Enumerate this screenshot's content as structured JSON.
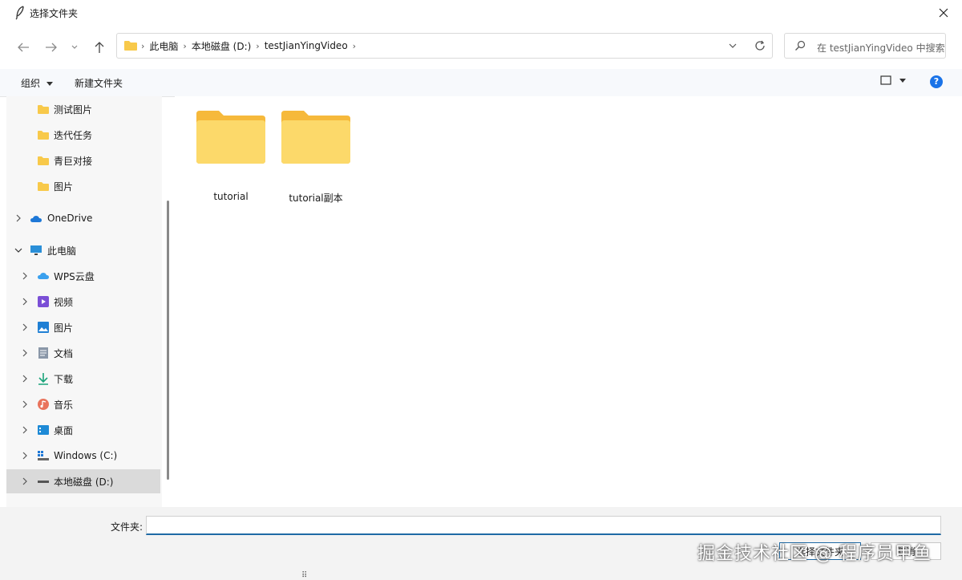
{
  "window": {
    "title": "选择文件夹"
  },
  "address": {
    "crumbs": [
      "此电脑",
      "本地磁盘 (D:)",
      "testJianYingVideo"
    ]
  },
  "search": {
    "placeholder": "在 testJianYingVideo 中搜索"
  },
  "toolbar": {
    "organize_label": "组织",
    "new_folder_label": "新建文件夹"
  },
  "sidebar": {
    "items": [
      {
        "label": "测试图片",
        "icon": "folder-icon"
      },
      {
        "label": "迭代任务",
        "icon": "folder-icon"
      },
      {
        "label": "青巨对接",
        "icon": "folder-icon"
      },
      {
        "label": "图片",
        "icon": "folder-icon"
      },
      {
        "label": "OneDrive",
        "icon": "cloud-icon"
      },
      {
        "label": "此电脑",
        "icon": "computer-icon"
      },
      {
        "label": "WPS云盘",
        "icon": "cloud-icon"
      },
      {
        "label": "视频",
        "icon": "video-icon"
      },
      {
        "label": "图片",
        "icon": "picture-icon"
      },
      {
        "label": "文档",
        "icon": "document-icon"
      },
      {
        "label": "下载",
        "icon": "download-icon"
      },
      {
        "label": "音乐",
        "icon": "music-icon"
      },
      {
        "label": "桌面",
        "icon": "desktop-icon"
      },
      {
        "label": "Windows (C:)",
        "icon": "drive-icon"
      },
      {
        "label": "本地磁盘 (D:)",
        "icon": "drive-icon",
        "selected": true
      }
    ]
  },
  "files": [
    {
      "name": "tutorial",
      "icon": "folder-icon"
    },
    {
      "name": "tutorial副本",
      "icon": "folder-icon"
    }
  ],
  "footer": {
    "folder_label": "文件夹:",
    "folder_value": "",
    "select_button": "选择文件夹",
    "cancel_button": "取消",
    "watermark": "掘金技术社区 @ 程序员甲鱼"
  },
  "colors": {
    "accent": "#1f6aa5",
    "folder": "#f8c94a",
    "selected_bg": "#dadada"
  }
}
